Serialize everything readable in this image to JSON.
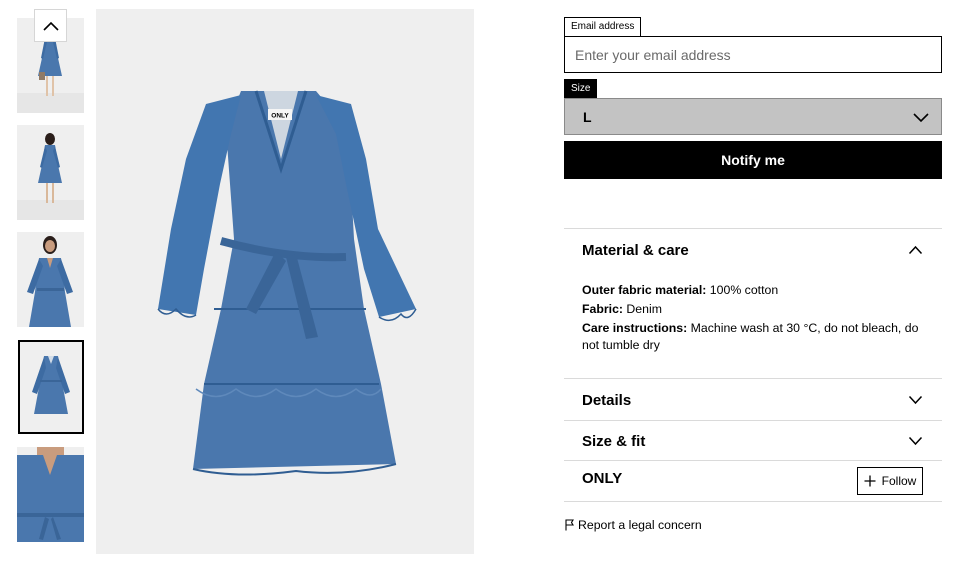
{
  "gallery": {
    "thumbnails": [
      {
        "label": "Front view full length",
        "selected": false
      },
      {
        "label": "Back view full length",
        "selected": false
      },
      {
        "label": "Model front close",
        "selected": false
      },
      {
        "label": "Packshot front",
        "selected": true
      },
      {
        "label": "Detail neckline and belt",
        "selected": false
      }
    ],
    "up_icon": "chevron-up-icon",
    "product_tag": "ONLY"
  },
  "form": {
    "email_label": "Email address",
    "email_placeholder": "Enter your email address",
    "email_value": "",
    "size_label": "Size",
    "size_value": "L",
    "notify_label": "Notify me"
  },
  "material_care": {
    "title": "Material & care",
    "outer_label": "Outer fabric material:",
    "outer_value": "100% cotton",
    "fabric_label": "Fabric:",
    "fabric_value": "Denim",
    "care_label": "Care instructions:",
    "care_value": "Machine wash at 30 °C, do not bleach, do not tumble dry"
  },
  "details": {
    "title": "Details"
  },
  "size_fit": {
    "title": "Size & fit"
  },
  "brand": {
    "name": "ONLY",
    "follow_label": "Follow"
  },
  "report": {
    "label": "Report a legal concern"
  },
  "colors": {
    "denim": "#4a77ad",
    "denim_dark": "#3a6598",
    "background": "#efefef",
    "button": "#000000",
    "select": "#c3c3c3"
  }
}
